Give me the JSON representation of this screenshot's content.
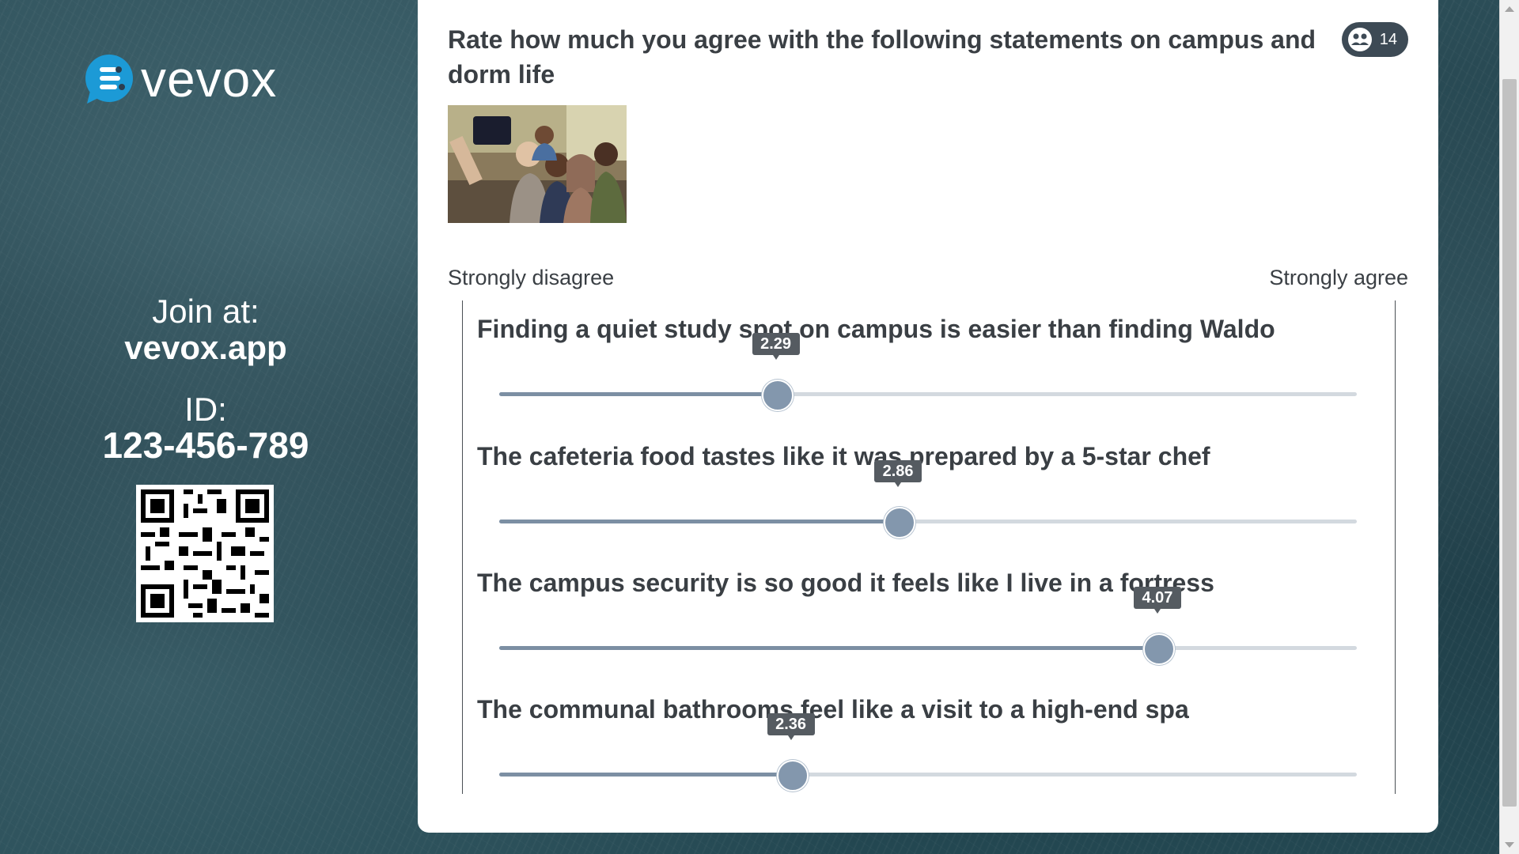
{
  "brand": {
    "name": "vevox",
    "logo_icon": "chat-bubble-logo-icon"
  },
  "join": {
    "label": "Join at:",
    "url": "vevox.app",
    "id_label": "ID:",
    "id_value": "123-456-789"
  },
  "question": {
    "title": "Rate how much you agree with the following statements on campus and dorm life",
    "participants_count": "14",
    "participants_icon": "people-icon",
    "image_icon": "group-selfie-photo"
  },
  "scale": {
    "min_label": "Strongly disagree",
    "max_label": "Strongly agree",
    "min": 1,
    "max": 5
  },
  "statements": [
    {
      "text": "Finding a quiet study spot on campus is easier than finding Waldo",
      "average": "2.29",
      "value": 2.29
    },
    {
      "text": "The cafeteria food tastes like it was prepared by a 5-star chef",
      "average": "2.86",
      "value": 2.86
    },
    {
      "text": "The campus security is so good it feels like I live in a fortress",
      "average": "4.07",
      "value": 4.07
    },
    {
      "text": "The communal bathrooms feel like a visit to a high-end spa",
      "average": "2.36",
      "value": 2.36
    }
  ],
  "colors": {
    "card": "#ffffff",
    "slider_fill": "#7c8fa3",
    "slider_track": "#d3d9df",
    "thumb": "#8397ad",
    "tooltip": "#555b61",
    "badge": "#3d4a55"
  }
}
